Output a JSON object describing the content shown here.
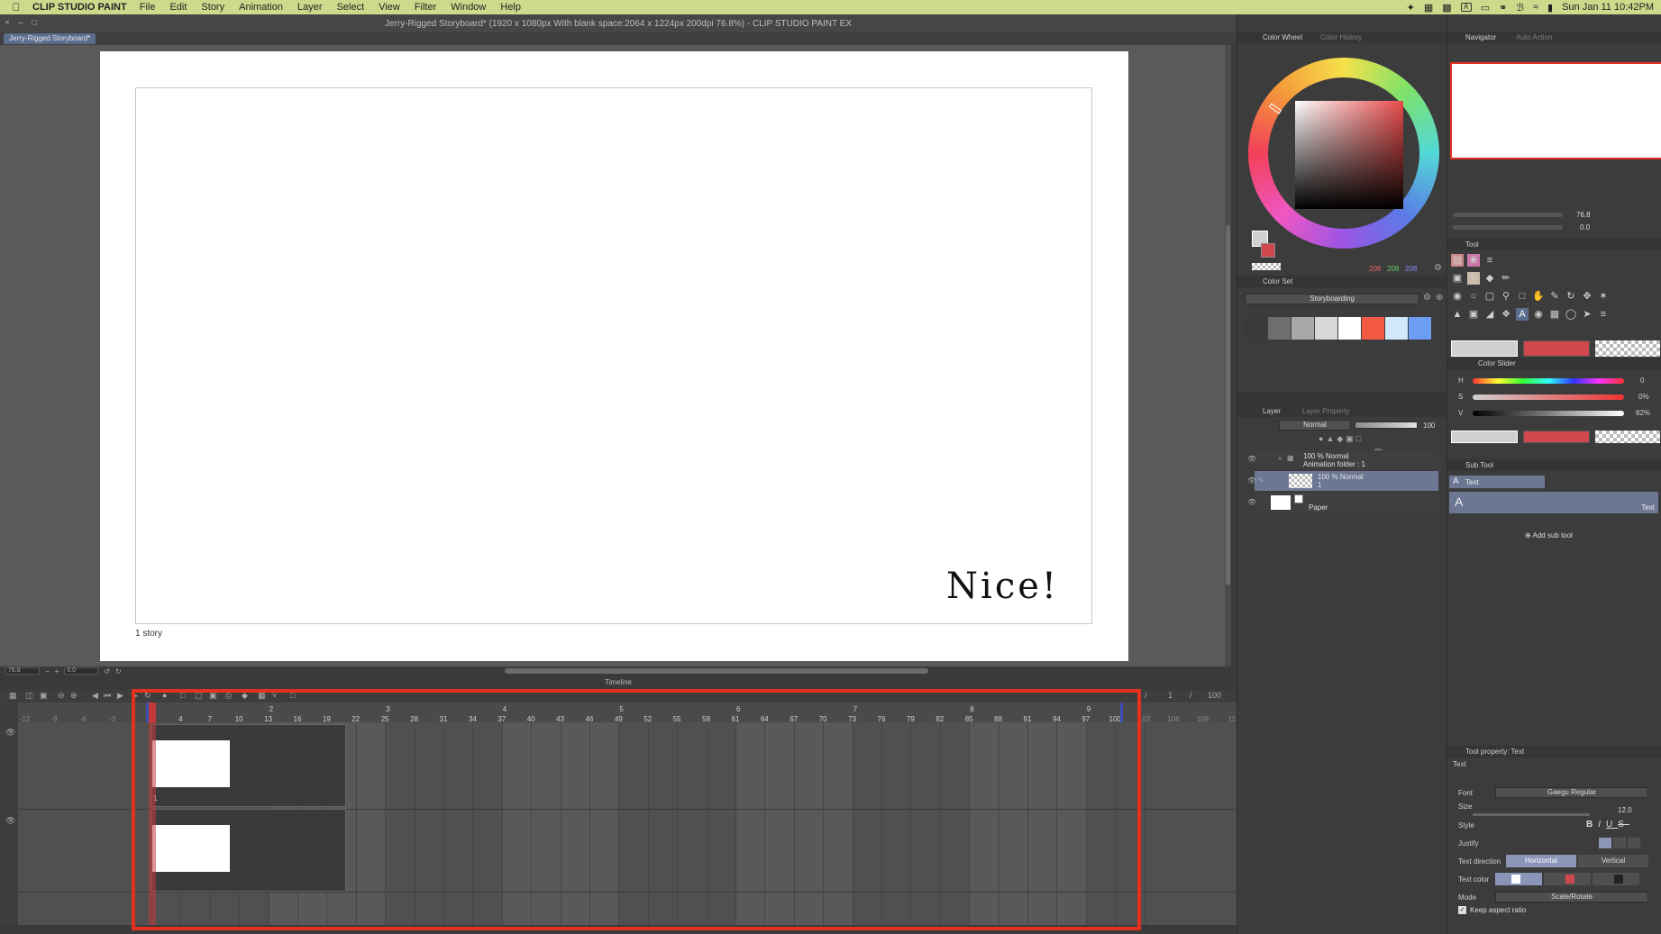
{
  "menubar": {
    "app_name": "CLIP STUDIO PAINT",
    "items": [
      "File",
      "Edit",
      "Story",
      "Animation",
      "Layer",
      "Select",
      "View",
      "Filter",
      "Window",
      "Help"
    ],
    "clock": "Sun Jan 11  10:42PM",
    "input_badge": "A"
  },
  "window": {
    "title": "Jerry-Rigged Storyboard* (1920 x 1080px With blank space:2064 x 1224px 200dpi 76.8%)  - CLIP STUDIO PAINT EX",
    "tab": "Jerry-Rigged Storyboard*"
  },
  "canvas": {
    "text": "Nice!",
    "story_label": "1 story"
  },
  "statusbar": {
    "zoom": "76.8",
    "rotation": "0.0"
  },
  "timeline": {
    "title": "Timeline",
    "current_frame": "1",
    "end_frame": "100",
    "ruler_before": [
      "-12",
      "-9",
      "-6",
      "-3"
    ],
    "ruler_after": [
      "103",
      "106",
      "109",
      "11"
    ],
    "ticks": [
      "1",
      "4",
      "7",
      "10",
      "13",
      "16",
      "19",
      "22",
      "25",
      "28",
      "31",
      "34",
      "37",
      "40",
      "43",
      "46",
      "49",
      "52",
      "55",
      "58",
      "61",
      "64",
      "67",
      "70",
      "73",
      "76",
      "79",
      "82",
      "85",
      "88",
      "91",
      "94",
      "97",
      "100"
    ],
    "second_marks": [
      "1",
      "2",
      "3",
      "4",
      "5",
      "6",
      "7",
      "8",
      "9"
    ],
    "cel_label": "1"
  },
  "color_wheel": {
    "tab_active": "Color Wheel",
    "tab_inactive": "Color History",
    "r": "208",
    "g": "208",
    "b": "208"
  },
  "color_set": {
    "title": "Color Set",
    "preset": "Storyboarding",
    "swatches": [
      "#3a3a3a",
      "#6e6e6e",
      "#a9a9a9",
      "#d8d8d8",
      "#ffffff",
      "#f35a44",
      "#cfe9fb",
      "#6d9cf3"
    ]
  },
  "layer_panel": {
    "tab_active": "Layer",
    "tab_inactive": "Layer Property",
    "blend_mode": "Normal",
    "opacity": "100",
    "layers": [
      {
        "line1": "100 % Normal",
        "line2": "Animation folder : 1"
      },
      {
        "line1": "100 % Normal",
        "line2": "1"
      },
      {
        "line1": "Paper",
        "line2": ""
      }
    ]
  },
  "navigator": {
    "tab_active": "Navigator",
    "tab_inactive": "Auto Action",
    "zoom": "76.8",
    "rotation": "0.0"
  },
  "tool_panel": {
    "title": "Tool"
  },
  "color_slider": {
    "title": "Color Slider",
    "h_label": "H",
    "h_value": "0",
    "s_label": "S",
    "s_value": "0%",
    "v_label": "V",
    "v_value": "82%"
  },
  "sub_tool": {
    "title": "Sub Tool",
    "item": "Text",
    "item_caption": "Text",
    "add": "Add sub tool"
  },
  "tool_property": {
    "title": "Tool property: Text",
    "section": "Text",
    "font_label": "Font",
    "font_value": "Gaegu Regular",
    "size_label": "Size",
    "size_value": "12.0",
    "style_label": "Style",
    "justify_label": "Justify",
    "direction_label": "Text direction",
    "direction_h": "Horizontal",
    "direction_v": "Vertical",
    "color_label": "Text color",
    "mode_label": "Mode",
    "mode_value": "Scale/Rotate",
    "keep_aspect": "Keep aspect ratio"
  },
  "colors": {
    "main_color": "#d0d0d0",
    "sub_color": "#d0474e",
    "highlight": "#e3301f"
  }
}
